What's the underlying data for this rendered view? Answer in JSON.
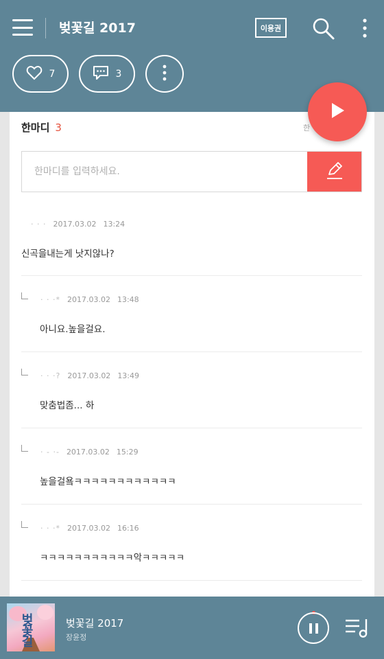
{
  "header": {
    "title": "벚꽃길 2017",
    "ticket_label": "이용권"
  },
  "actions": {
    "like_count": "7",
    "comment_count": "3"
  },
  "comments_section": {
    "title": "한마디",
    "count": "3",
    "more_label": "한",
    "input_placeholder": "한마디를 입력하세요.",
    "comments": [
      {
        "author": "· ·  ·",
        "date": "2017.03.02",
        "time": "13:24",
        "text": "신곡을내는게 낫지않나?",
        "reply": false
      },
      {
        "author": "· ·  ·*",
        "date": "2017.03.02",
        "time": "13:48",
        "text": "아니요.높을걸요.",
        "reply": true
      },
      {
        "author": "·  ·  ·?",
        "date": "2017.03.02",
        "time": "13:49",
        "text": "맞춤법좀... 하",
        "reply": true
      },
      {
        "author": "· - ·-",
        "date": "2017.03.02",
        "time": "15:29",
        "text": "높을걸욬ㅋㅋㅋㅋㅋㅋㅋㅋㅋㅋㅋㅋ",
        "reply": true
      },
      {
        "author": "· ·  ·*",
        "date": "2017.03.02",
        "time": "16:16",
        "text": "ㅋㅋㅋㅋㅋㅋㅋㅋㅋㅋㅋ악ㅋㅋㅋㅋㅋ",
        "reply": true
      }
    ]
  },
  "player": {
    "title": "벚꽃길 2017",
    "artist": "장윤정",
    "album_art_text": "벚꽃길"
  },
  "colors": {
    "header_bg": "#5e8597",
    "accent": "#f65a55",
    "count_color": "#e5533f"
  },
  "icons": [
    "menu-icon",
    "search-icon",
    "more-vertical-icon",
    "heart-icon",
    "comment-icon",
    "play-icon",
    "pencil-icon",
    "pause-icon",
    "playlist-icon"
  ]
}
